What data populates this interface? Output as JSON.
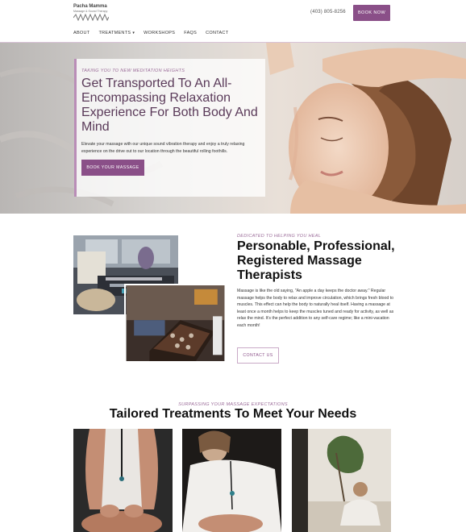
{
  "header": {
    "logo": {
      "title": "Pacha Mamma",
      "subtitle": "Massage & Sound Therapy"
    },
    "phone": "(403) 805-8256",
    "book_label": "BOOK NOW",
    "nav": [
      {
        "label": "ABOUT"
      },
      {
        "label": "TREATMENTS"
      },
      {
        "label": "WORKSHOPS"
      },
      {
        "label": "FAQS"
      },
      {
        "label": "CONTACT"
      }
    ]
  },
  "hero": {
    "eyebrow": "TAKING YOU TO NEW MEDITATION HEIGHTS",
    "title": "Get Transported To An All-Encompassing Relaxation Experience For Both Body And Mind",
    "text": "Elevate your massage with our unique sound vibration therapy and enjoy a truly relaxing experience on the drive out to our location through the beautiful rolling foothills.",
    "button_label": "BOOK YOUR MASSAGE"
  },
  "about": {
    "eyebrow": "DEDICATED TO HELPING YOU HEAL",
    "title": "Personable, Professional, Registered Massage Therapists",
    "text": "Massage is like the old saying, \"An apple a day keeps the doctor away.\" Regular massage helps the body to relax and improve circulation, which brings fresh blood to muscles. This effect can help the body to naturally heal itself. Having a massage at least once a month helps to keep the muscles tuned and ready for activity, as well as relax the mind. It's the perfect addition to any self-care regime; like a mini-vacation each month!",
    "button_label": "CONTACT US"
  },
  "treatments": {
    "eyebrow": "SURPASSING YOUR MASSAGE EXPECTATIONS",
    "title": "Tailored Treatments To Meet Your Needs"
  },
  "colors": {
    "accent": "#8a4f88",
    "eyebrow": "#9a6a98",
    "hero_title": "#5a3a59"
  }
}
